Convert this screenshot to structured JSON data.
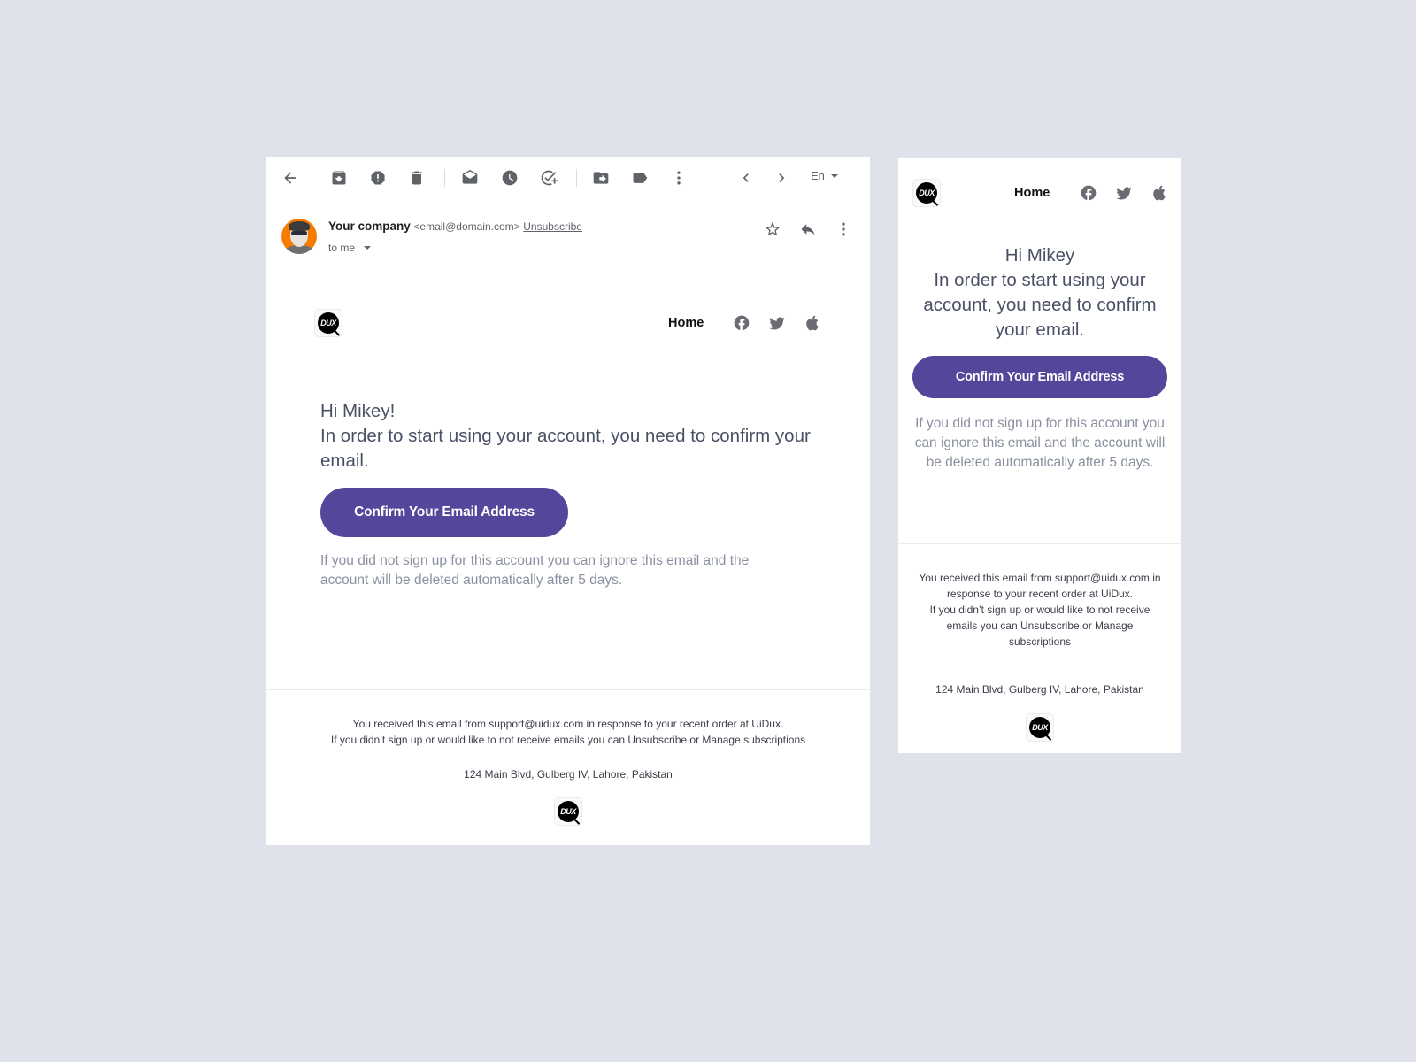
{
  "desktop": {
    "toolbar": {
      "back": "arrow-back-icon",
      "buttons": [
        {
          "name": "archive-button",
          "icon": "archive-icon"
        },
        {
          "name": "report-spam-button",
          "icon": "report-spam-icon"
        },
        {
          "name": "delete-button",
          "icon": "trash-icon"
        },
        {
          "name": "mark-unread-button",
          "icon": "mark-unread-icon"
        },
        {
          "name": "snooze-button",
          "icon": "clock-icon"
        },
        {
          "name": "add-task-button",
          "icon": "add-task-icon"
        },
        {
          "name": "move-to-button",
          "icon": "move-to-folder-icon"
        },
        {
          "name": "label-button",
          "icon": "label-icon"
        },
        {
          "name": "more-button",
          "icon": "more-vertical-icon"
        }
      ],
      "prev": "chevron-left-icon",
      "next": "chevron-right-icon",
      "language": "En"
    },
    "header": {
      "sender_name": "Your company",
      "sender_email": "<email@domain.com>",
      "unsubscribe_label": "Unsubscribe",
      "recipient_label": "to me"
    },
    "email": {
      "nav_home": "Home",
      "greeting_line1": "Hi Mikey!",
      "greeting_line2": "In order to start using your account, you need to confirm your email.",
      "cta_label": "Confirm Your Email Address",
      "note": "If you did not sign up for this account you can ignore this email and the account will be deleted automatically after 5 days.",
      "footer_line1": "You received this email from support@uidux.com in response to your recent order at UiDux.",
      "footer_line2": "If you didn’t sign up or would like to not receive emails you can Unsubscribe or Manage subscriptions",
      "address": "124 Main Blvd, Gulberg IV, Lahore, Pakistan",
      "logo_text": "DUX"
    }
  },
  "mobile": {
    "nav_home": "Home",
    "greeting_line1": "Hi Mikey",
    "greeting_line2": "In order to start using your account, you need to confirm your email.",
    "cta_label": "Confirm Your Email Address",
    "note": "If you did not sign up for this account you can ignore this email and the account will be deleted automatically after 5 days.",
    "footer_line1": "You received this email from support@uidux.com in response to your recent order at UiDux.",
    "footer_line2": "If you didn’t sign up or would like to not receive emails you can Unsubscribe or Manage subscriptions",
    "address": "124 Main Blvd, Gulberg IV, Lahore, Pakistan",
    "logo_text": "DUX"
  },
  "colors": {
    "background": "#dfe2ea",
    "brand_button": "#52479a",
    "avatar_bg": "#f57c00",
    "heading_text": "#4a5166",
    "muted_text": "#8a90a0"
  }
}
